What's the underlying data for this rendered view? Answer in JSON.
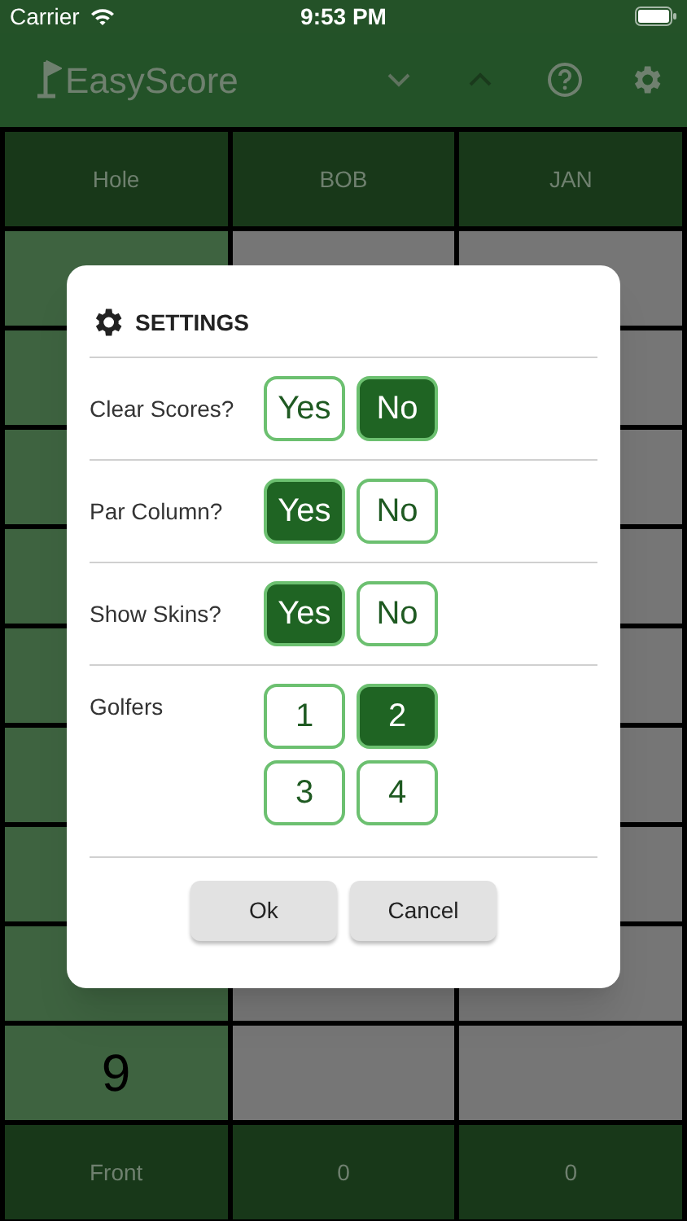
{
  "status_bar": {
    "carrier": "Carrier",
    "time": "9:53 PM"
  },
  "header": {
    "title": "EasyScore"
  },
  "table": {
    "columns": [
      "Hole",
      "BOB",
      "JAN"
    ],
    "rows": [
      {},
      {},
      {},
      {},
      {},
      {},
      {},
      {},
      {
        "hole": "9"
      }
    ],
    "footer": [
      "Front",
      "0",
      "0"
    ]
  },
  "dialog": {
    "title": "SETTINGS",
    "options": [
      {
        "label": "Clear Scores?",
        "kind": "toggle",
        "choices": [
          {
            "label": "Yes",
            "selected": false
          },
          {
            "label": "No",
            "selected": true
          }
        ]
      },
      {
        "label": "Par Column?",
        "kind": "toggle",
        "choices": [
          {
            "label": "Yes",
            "selected": true
          },
          {
            "label": "No",
            "selected": false
          }
        ]
      },
      {
        "label": "Show Skins?",
        "kind": "toggle",
        "choices": [
          {
            "label": "Yes",
            "selected": true
          },
          {
            "label": "No",
            "selected": false
          }
        ]
      },
      {
        "label": "Golfers",
        "kind": "grid",
        "choices": [
          {
            "label": "1",
            "selected": false
          },
          {
            "label": "2",
            "selected": true
          },
          {
            "label": "3",
            "selected": false
          },
          {
            "label": "4",
            "selected": false
          }
        ]
      }
    ],
    "buttons": [
      "Ok",
      "Cancel"
    ]
  }
}
